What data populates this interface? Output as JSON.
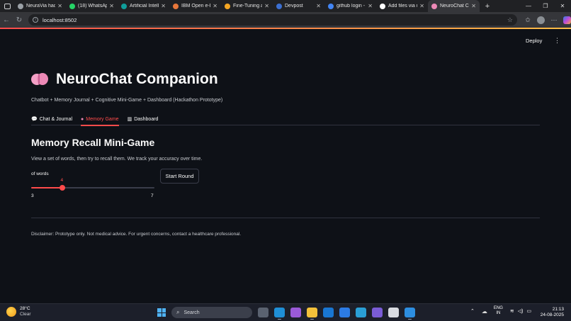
{
  "browser": {
    "tabs": [
      {
        "title": "NeuraVia hack",
        "icon": "generic-favicon",
        "color": "#9aa0a6"
      },
      {
        "title": "(18) WhatsApp",
        "icon": "whatsapp-icon",
        "color": "#25d366"
      },
      {
        "title": "Artificial Intelli",
        "icon": "logo-favicon",
        "color": "#0f9d9a"
      },
      {
        "title": "IBM Open e-Le",
        "icon": "ibm-icon",
        "color": "#e8773a"
      },
      {
        "title": "Fine-Tuning a",
        "icon": "chain-icon",
        "color": "#f5a623"
      },
      {
        "title": "Devpost",
        "icon": "devpost-icon",
        "color": "#3b6fd1"
      },
      {
        "title": "github login -",
        "icon": "search-icon",
        "color": "#4285f4"
      },
      {
        "title": "Add files via up",
        "icon": "github-icon",
        "color": "#ffffff"
      },
      {
        "title": "NeuroChat Com",
        "icon": "brain-icon",
        "color": "#ec89b6",
        "active": true
      }
    ],
    "url": "localhost:8502"
  },
  "header": {
    "deploy_label": "Deploy",
    "menu_icon": "kebab-menu-icon"
  },
  "app": {
    "title": "NeuroChat Companion",
    "title_icon": "brain-emoji",
    "subtitle": "Chatbot + Memory Journal + Cognitive Mini-Game + Dashboard (Hackathon Prototype)",
    "tabs": [
      {
        "label": "Chat & Journal",
        "icon": "speech-bubble-icon",
        "active": false
      },
      {
        "label": "Memory Game",
        "icon": "brain-icon",
        "active": true
      },
      {
        "label": "Dashboard",
        "icon": "chart-icon",
        "active": false
      }
    ],
    "game": {
      "title": "Memory Recall Mini-Game",
      "description": "View a set of words, then try to recall them. We track your accuracy over time.",
      "slider": {
        "label": "of words",
        "value": 4,
        "min": 3,
        "max": 7
      },
      "start_label": "Start Round"
    },
    "disclaimer": "Disclaimer: Prototype only. Not medical advice. For urgent concerns, contact a healthcare professional.",
    "accent_color": "#ff4b4b"
  },
  "taskbar": {
    "weather": {
      "temp": "28°C",
      "condition": "Clear"
    },
    "search_placeholder": "Search",
    "apps": [
      {
        "name": "file-explorer-icon",
        "color": "#5a6270"
      },
      {
        "name": "edge-icon",
        "color": "#1f8fd6",
        "running": true
      },
      {
        "name": "copilot-icon",
        "color": "#9a5ad8"
      },
      {
        "name": "folder-icon",
        "color": "#f3c13a",
        "running": true
      },
      {
        "name": "outlook-icon",
        "color": "#1976d2"
      },
      {
        "name": "dropbox-icon",
        "color": "#2c7be5"
      },
      {
        "name": "store-icon",
        "color": "#2a9fd6"
      },
      {
        "name": "copilot-app-icon",
        "color": "#7a5cd6"
      },
      {
        "name": "notepad-icon",
        "color": "#d8dbe1"
      },
      {
        "name": "vscode-icon",
        "color": "#2d8ee0",
        "running": true
      }
    ],
    "language": {
      "line1": "ENG",
      "line2": "IN"
    },
    "time": "21:13",
    "date": "24-08-2025"
  }
}
